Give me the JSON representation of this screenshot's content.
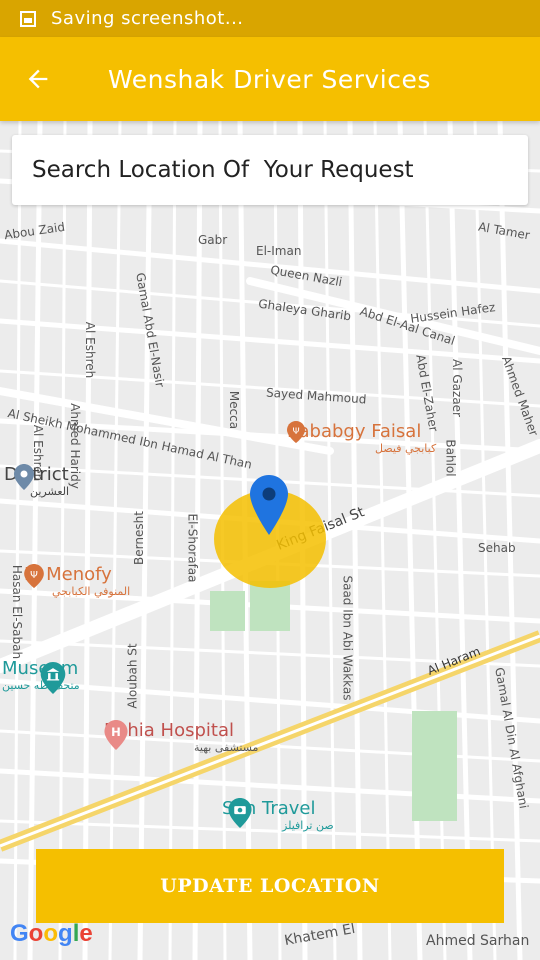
{
  "status_bar": {
    "text": "Saving screenshot..."
  },
  "app_bar": {
    "title": "Wenshak Driver Services"
  },
  "search": {
    "placeholder": "Search Location Of  Your Request"
  },
  "map": {
    "streets": [
      {
        "name": "Abou Zaid"
      },
      {
        "name": "Gabr"
      },
      {
        "name": "El-Iman"
      },
      {
        "name": "Queen Nazli"
      },
      {
        "name": "Al Tamer"
      },
      {
        "name": "Ghaleya Gharib"
      },
      {
        "name": "Hussein Hafez"
      },
      {
        "name": "Abd El-Aal Canal"
      },
      {
        "name": "Gamal Abd El-Nasir"
      },
      {
        "name": "Al Eshreh"
      },
      {
        "name": "Al Sheikh Mohammed Ibn Hamad Al Than"
      },
      {
        "name": "Ahmed Haridy"
      },
      {
        "name": "Al Eshren"
      },
      {
        "name": "Mecca"
      },
      {
        "name": "Sayed Mahmoud"
      },
      {
        "name": "Abd El-Zaher"
      },
      {
        "name": "Al Gazaer"
      },
      {
        "name": "Ahmed Maher"
      },
      {
        "name": "Bahlol"
      },
      {
        "name": "King Faisal St"
      },
      {
        "name": "El-Shorafaa"
      },
      {
        "name": "Bernesht"
      },
      {
        "name": "Sehab"
      },
      {
        "name": "Saad Ibn Abi Wakkas"
      },
      {
        "name": "Al Haram"
      },
      {
        "name": "Aloubah St"
      },
      {
        "name": "Gamal Al Din Al Afghani"
      },
      {
        "name": "Hasan El-Sabah"
      },
      {
        "name": "Khatem El"
      },
      {
        "name": "Ahmed Sarhan"
      }
    ],
    "pois": [
      {
        "name": "Kababgy Faisal",
        "subtitle": "كبابجي فيصل",
        "color": "#d7733c",
        "icon": "restaurant-icon"
      },
      {
        "name": "District",
        "subtitle": "العشرين",
        "color": "#444444",
        "icon": "location-icon"
      },
      {
        "name": "El Menofy",
        "subtitle": "المنوفي الكبابجي",
        "color": "#d7733c",
        "icon": "restaurant-icon"
      },
      {
        "name": "Museum",
        "subtitle": "متحف طه حسين",
        "color": "#1f9a9a",
        "icon": "museum-icon"
      },
      {
        "name": "Bahia Hospital",
        "subtitle": "مستشفى بهية",
        "color": "#c0504d",
        "icon": "hospital-icon"
      },
      {
        "name": "Sun Travel",
        "subtitle": "صن ترافيلز",
        "color": "#1f9a9a",
        "icon": "camera-icon"
      }
    ]
  },
  "update_button": {
    "label": "UPDATE LOCATION"
  },
  "google_logo": {
    "g1": "G",
    "o1": "o",
    "o2": "o",
    "g2": "g",
    "l": "l",
    "e": "e"
  },
  "colors": {
    "accent": "#f5bf00",
    "status_bar": "#d9a500",
    "pin": "#1f74e0"
  }
}
